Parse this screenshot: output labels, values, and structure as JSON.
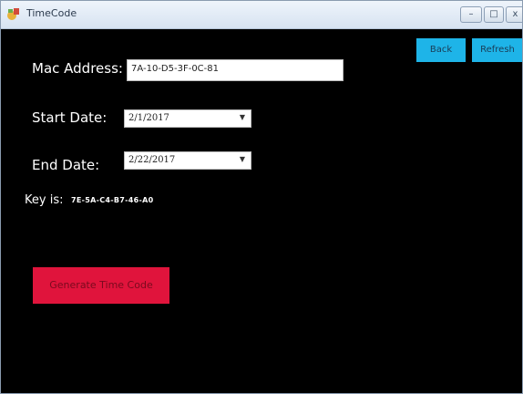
{
  "window": {
    "title": "TimeCode",
    "controls": {
      "minimize": "–",
      "maximize": "□",
      "close": "x"
    }
  },
  "toolbar": {
    "back_label": "Back",
    "refresh_label": "Refresh"
  },
  "form": {
    "mac_address": {
      "label": "Mac Address:",
      "value": "7A-10-D5-3F-0C-81"
    },
    "start_date": {
      "label": "Start Date:",
      "value": "2/1/2017"
    },
    "end_date": {
      "label": "End Date:",
      "value": "2/22/2017"
    },
    "key": {
      "label": "Key is:",
      "value": "7E-5A-C4-B7-46-A0"
    }
  },
  "actions": {
    "generate_label": "Generate Time Code"
  },
  "colors": {
    "background": "#000000",
    "accent_button": "#1eb4e8",
    "generate_button": "#e0143c"
  }
}
